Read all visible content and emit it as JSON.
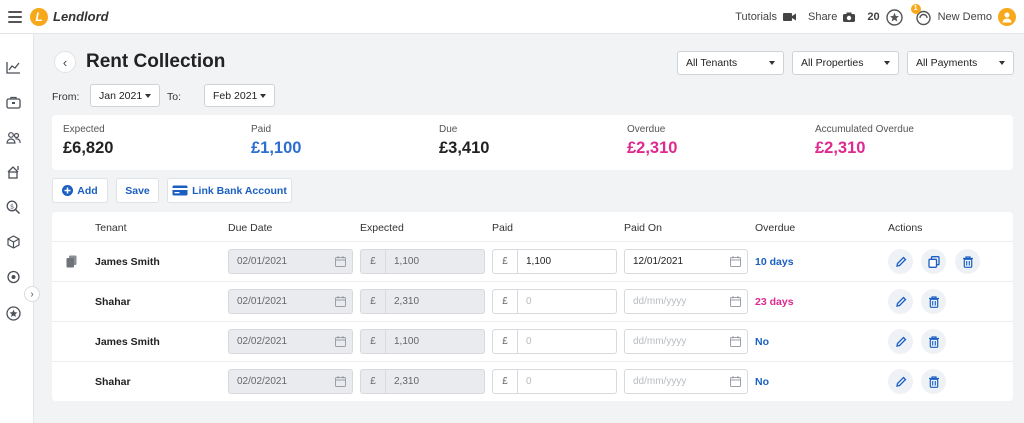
{
  "topbar": {
    "logo_letter": "L",
    "app_name": "Lendlord",
    "tutorials": "Tutorials",
    "share": "Share",
    "points": "20",
    "notif_count": "1",
    "user": "New Demo"
  },
  "sidebar": {
    "icons": [
      "chart-line-icon",
      "briefcase-icon",
      "users-icon",
      "property-icon",
      "search-money-icon",
      "boxes-icon",
      "sync-icon",
      "star-icon"
    ]
  },
  "page": {
    "title": "Rent Collection",
    "filters": [
      "All Tenants",
      "All Properties",
      "All Payments"
    ],
    "from_label": "From:",
    "from_value": "Jan 2021",
    "to_label": "To:",
    "to_value": "Feb 2021"
  },
  "summary": [
    {
      "label": "Expected",
      "value": "£6,820",
      "color": "#222222"
    },
    {
      "label": "Paid",
      "value": "£1,100",
      "color": "#2d6fd1"
    },
    {
      "label": "Due",
      "value": "£3,410",
      "color": "#222222"
    },
    {
      "label": "Overdue",
      "value": "£2,310",
      "color": "#e0288f"
    },
    {
      "label": "Accumulated Overdue",
      "value": "£2,310",
      "color": "#e0288f"
    }
  ],
  "actions": {
    "add": "Add",
    "save": "Save",
    "link_bank": "Link Bank Account"
  },
  "table": {
    "headers": [
      "Tenant",
      "Due Date",
      "Expected",
      "Paid",
      "Paid On",
      "Overdue",
      "Actions"
    ],
    "currency": "£",
    "date_placeholder": "dd/mm/yyyy",
    "paid_placeholder": "0",
    "rows": [
      {
        "tenant": "James Smith",
        "due_date": "02/01/2021",
        "expected": "1,100",
        "paid": "1,100",
        "paid_on": "12/01/2021",
        "overdue": "10 days",
        "overdue_color": "#1a5fc2"
      },
      {
        "tenant": "Shahar",
        "due_date": "02/01/2021",
        "expected": "2,310",
        "paid": "",
        "paid_on": "",
        "overdue": "23 days",
        "overdue_color": "#e0288f"
      },
      {
        "tenant": "James Smith",
        "due_date": "02/02/2021",
        "expected": "1,100",
        "paid": "",
        "paid_on": "",
        "overdue": "No",
        "overdue_color": "#1a5fc2"
      },
      {
        "tenant": "Shahar",
        "due_date": "02/02/2021",
        "expected": "2,310",
        "paid": "",
        "paid_on": "",
        "overdue": "No",
        "overdue_color": "#1a5fc2"
      }
    ]
  },
  "colors": {
    "accent": "#1a5fc2",
    "brand": "#f7a81b",
    "overdue": "#e0288f"
  }
}
